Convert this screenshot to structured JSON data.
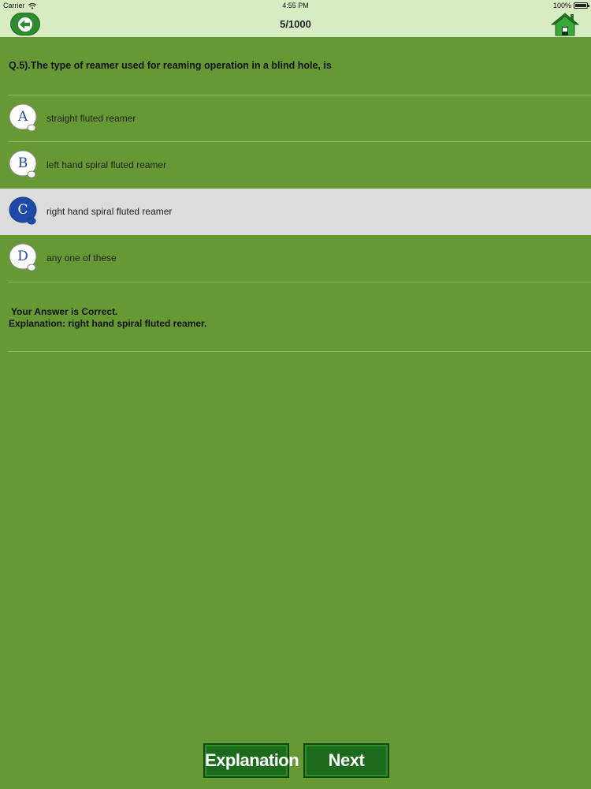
{
  "status_bar": {
    "carrier": "Carrier",
    "time": "4:55 PM",
    "battery": "100%",
    "battery_level": 1.0
  },
  "nav": {
    "title": "5/1000"
  },
  "question": {
    "text": "Q.5).The type of reamer used for reaming operation in a blind hole, is"
  },
  "options": [
    {
      "letter": "A",
      "text": "straight fluted reamer",
      "selected": false
    },
    {
      "letter": "B",
      "text": "left hand spiral fluted reamer",
      "selected": false
    },
    {
      "letter": "C",
      "text": "right hand spiral fluted reamer",
      "selected": true
    },
    {
      "letter": "D",
      "text": "any one of these",
      "selected": false
    }
  ],
  "result": {
    "line1": "Your Answer is Correct.",
    "line2": "Explanation: right hand spiral fluted reamer."
  },
  "buttons": {
    "explanation": "Explanation",
    "next": "Next"
  },
  "colors": {
    "background": "#669933",
    "nav_background": "#d8ecc4",
    "selected_row": "#dcdcdc",
    "button_green": "#1c6b1c",
    "letter_blue": "#2a4aa0"
  }
}
